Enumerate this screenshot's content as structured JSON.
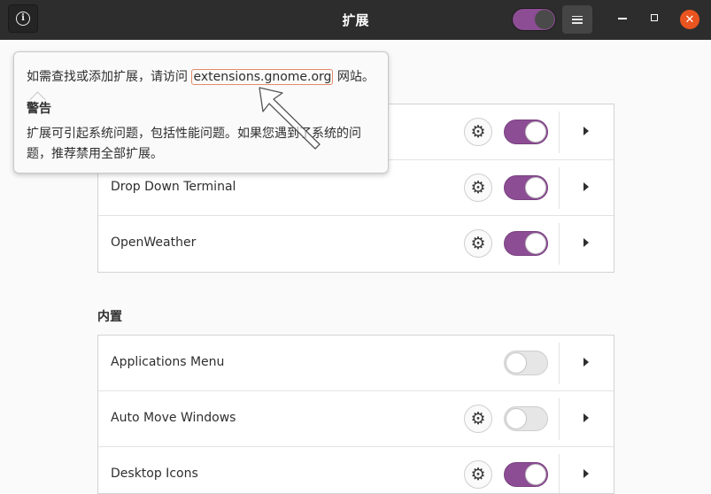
{
  "window": {
    "title": "扩展",
    "info_icon": "info-icon",
    "menu_icon": "hamburger-menu-icon",
    "close_glyph": "✕",
    "accent_color": "#8c4d94",
    "close_color": "#e95420"
  },
  "popover": {
    "text_before": "如需查找或添加扩展，请访问 ",
    "link": "extensions.gnome.org",
    "text_after": " 网站。",
    "warning_title": "警告",
    "warning_text": "扩展可引起系统问题，包括性能问题。如果您遇到了系统的问题，推荐禁用全部扩展。"
  },
  "user_extensions": [
    {
      "label": "",
      "has_settings": true,
      "enabled": true
    },
    {
      "label": "Drop Down Terminal",
      "has_settings": true,
      "enabled": true
    },
    {
      "label": "OpenWeather",
      "has_settings": true,
      "enabled": true
    }
  ],
  "builtin": {
    "title": "内置",
    "items": [
      {
        "label": "Applications Menu",
        "has_settings": false,
        "enabled": false
      },
      {
        "label": "Auto Move Windows",
        "has_settings": true,
        "enabled": false
      },
      {
        "label": "Desktop Icons",
        "has_settings": true,
        "enabled": true
      }
    ]
  }
}
